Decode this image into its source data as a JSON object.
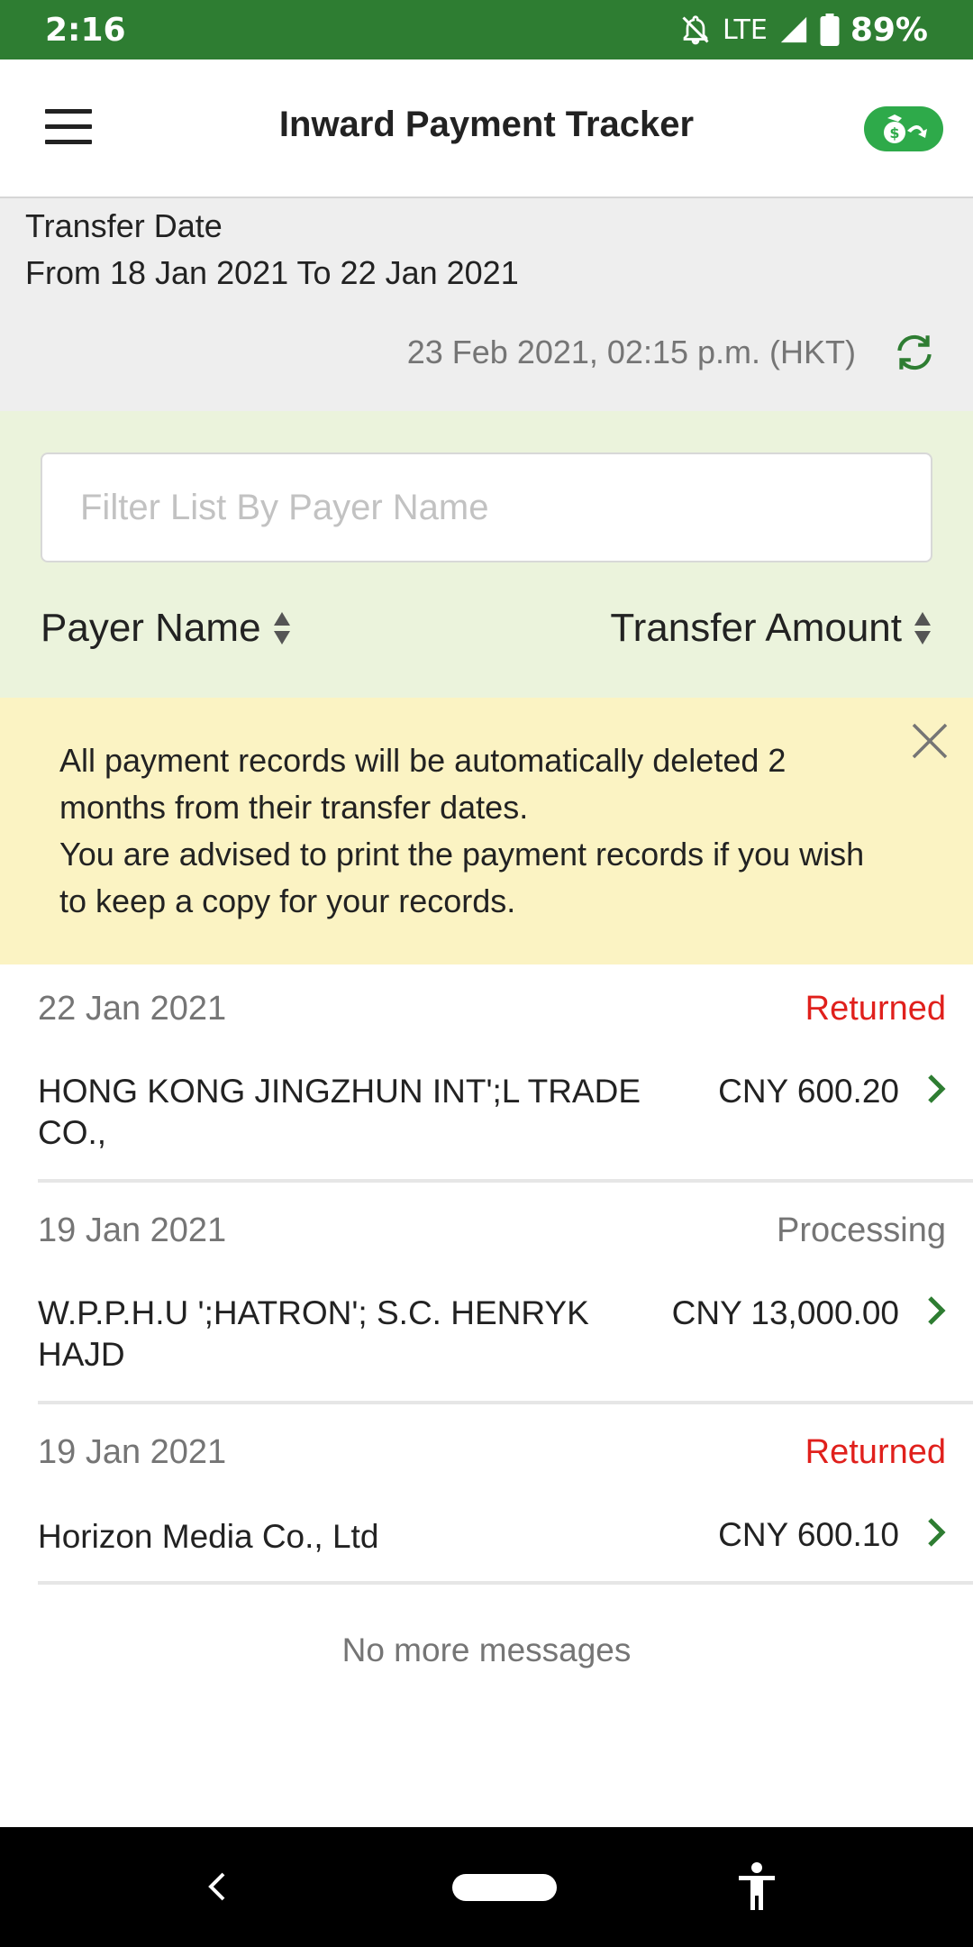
{
  "status_bar": {
    "time": "2:16",
    "network": "LTE",
    "battery": "89%",
    "icons": [
      "bell-off-icon",
      "signal-icon",
      "battery-icon"
    ]
  },
  "app_bar": {
    "title": "Inward Payment Tracker",
    "menu_icon": "hamburger-menu-icon",
    "action_icon": "money-bag-return-icon",
    "accent": "#2eaa4a"
  },
  "date_header": {
    "label": "Transfer Date",
    "range": "From 18 Jan 2021 To 22 Jan 2021",
    "updated": "23 Feb 2021, 02:15 p.m. (HKT)",
    "refresh_icon": "refresh-icon"
  },
  "filter": {
    "placeholder": "Filter List By Payer Name",
    "value": "",
    "sort_payer_label": "Payer Name",
    "sort_amount_label": "Transfer Amount"
  },
  "notice": {
    "line1": "All payment records will be automatically deleted 2 months from their transfer dates.",
    "line2": "You are advised to print the payment records if you wish to keep a copy for your records."
  },
  "records": [
    {
      "date": "22 Jan 2021",
      "status": "Returned",
      "payer": "HONG KONG JINGZHUN INT';L TRADE CO.,",
      "amount": "CNY 600.20"
    },
    {
      "date": "19 Jan 2021",
      "status": "Processing",
      "payer": "W.P.P.H.U ';HATRON'; S.C. HENRYK HAJD",
      "amount": "CNY 13,000.00"
    },
    {
      "date": "19 Jan 2021",
      "status": "Returned",
      "payer": "Horizon Media Co., Ltd",
      "amount": "CNY 600.10"
    }
  ],
  "footer": {
    "no_more": "No more messages"
  },
  "colors": {
    "status_bar": "#2e7d32",
    "returned": "#e0201c",
    "chevron": "#2e7d32",
    "filter_bg": "#ebf3dc",
    "notice_bg": "#fbf3c3"
  }
}
